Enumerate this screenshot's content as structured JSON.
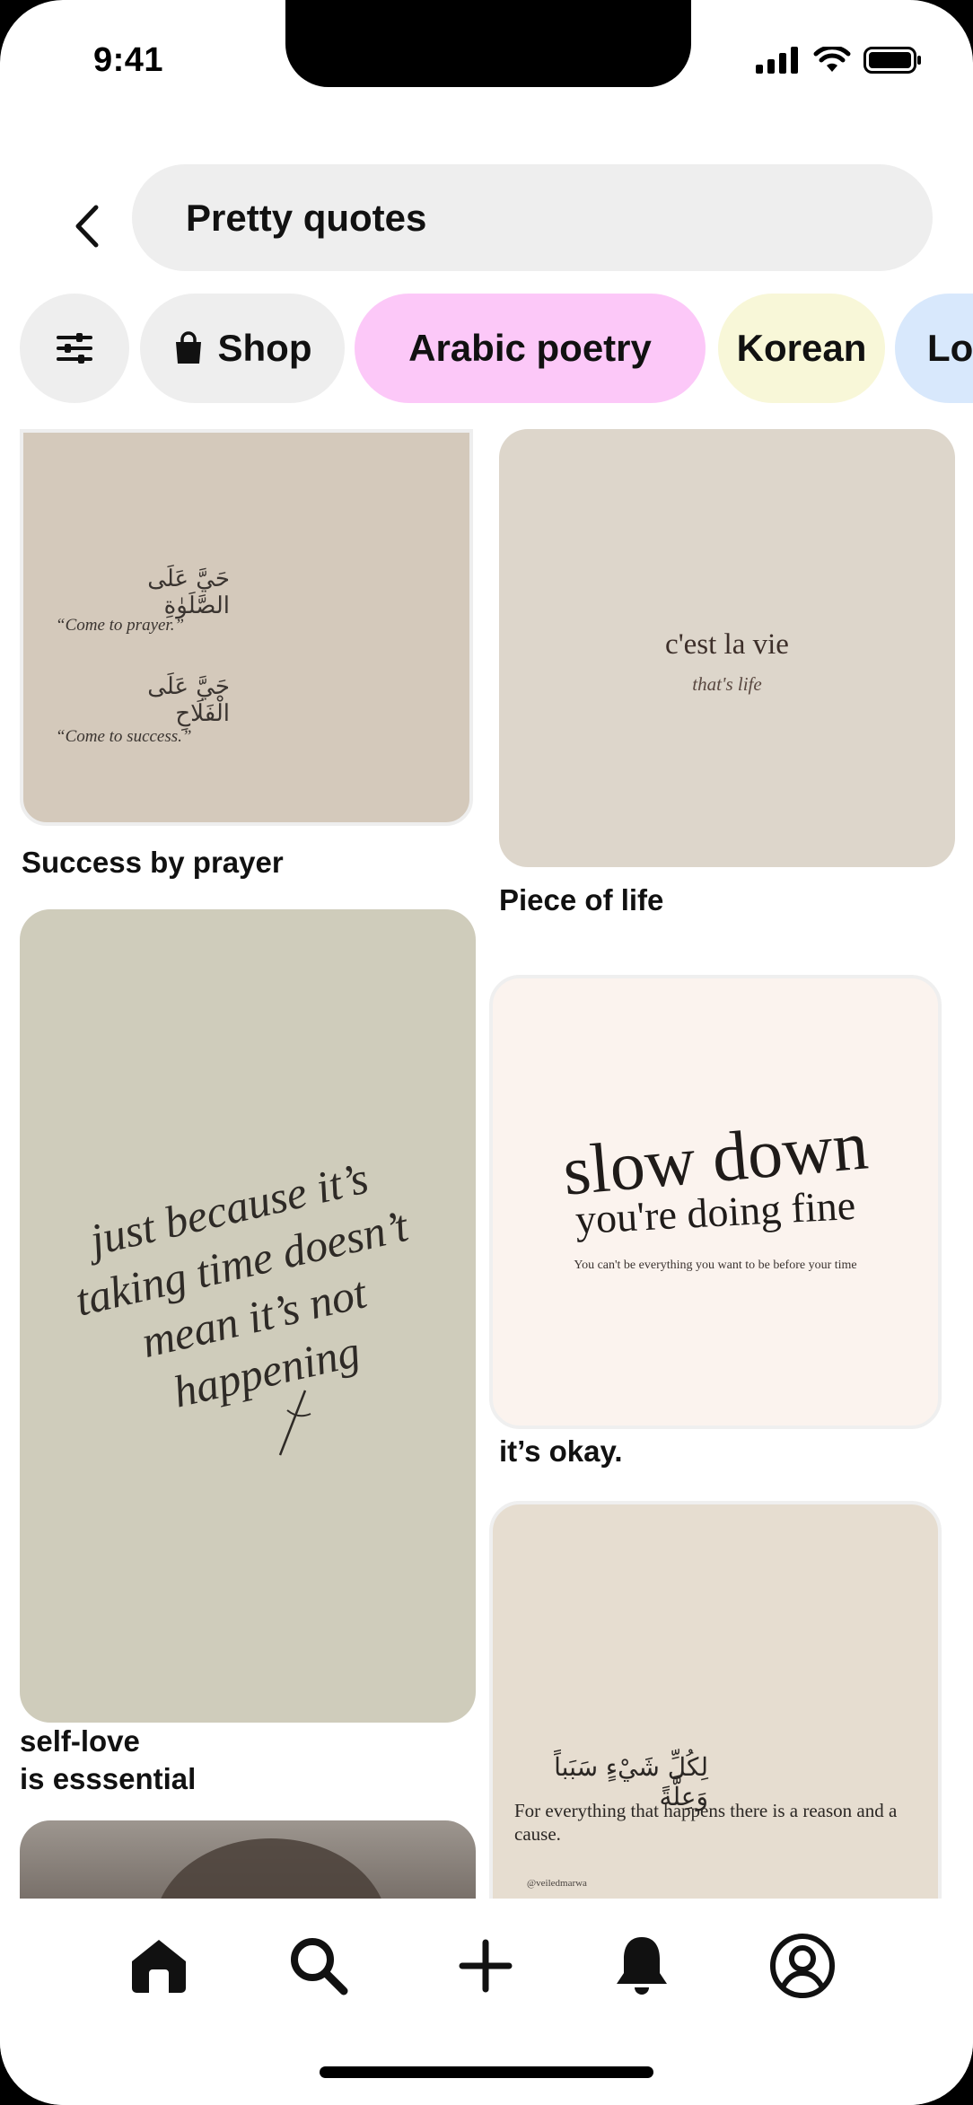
{
  "status": {
    "time": "9:41"
  },
  "search": {
    "query": "Pretty quotes"
  },
  "chips": [
    {
      "label": "",
      "icon": "filter-sliders-icon",
      "bg": "#eeeeee"
    },
    {
      "label": "Shop",
      "icon": "shopping-bag-icon",
      "bg": "#eeeeee"
    },
    {
      "label": "Arabic poetry",
      "bg": "#fcc8f8"
    },
    {
      "label": "Korean",
      "bg": "#f8f7d8"
    },
    {
      "label": "Lo",
      "bg": "#d8e8fc"
    }
  ],
  "pins": [
    {
      "title": "Success by prayer",
      "image": {
        "arabic_1": "حَيَّ عَلَى الصَّلَوٰةِ",
        "english_1": "“Come to prayer.”",
        "arabic_2": "حَيَّ عَلَى الْفَلَاحِ",
        "english_2": "“Come to success.”"
      }
    },
    {
      "title": "Piece of life",
      "image": {
        "line_1": "c'est la vie",
        "line_2": "that's life"
      }
    },
    {
      "title_line_1": "self-love",
      "title_line_2": "is esssential",
      "image": {
        "quote": [
          "just because it’s",
          "taking time doesn’t",
          "mean it’s not",
          "happening"
        ]
      }
    },
    {
      "title": "it’s okay.",
      "image": {
        "line_1": "slow down",
        "line_2": "you're doing fine",
        "caption": "You can't be everything you want to be before your time"
      }
    },
    {
      "title": "",
      "image": {
        "arabic": "لِكُلِّ شَيْءٍ سَبَباً وَعِلَّةً",
        "english": "For everything that happens there is a reason and a cause.",
        "handle": "@veiledmarwa"
      }
    }
  ],
  "nav": [
    {
      "name": "home",
      "icon": "home-icon"
    },
    {
      "name": "search",
      "icon": "search-icon"
    },
    {
      "name": "create",
      "icon": "plus-icon"
    },
    {
      "name": "notifications",
      "icon": "bell-icon"
    },
    {
      "name": "profile",
      "icon": "profile-icon"
    }
  ]
}
